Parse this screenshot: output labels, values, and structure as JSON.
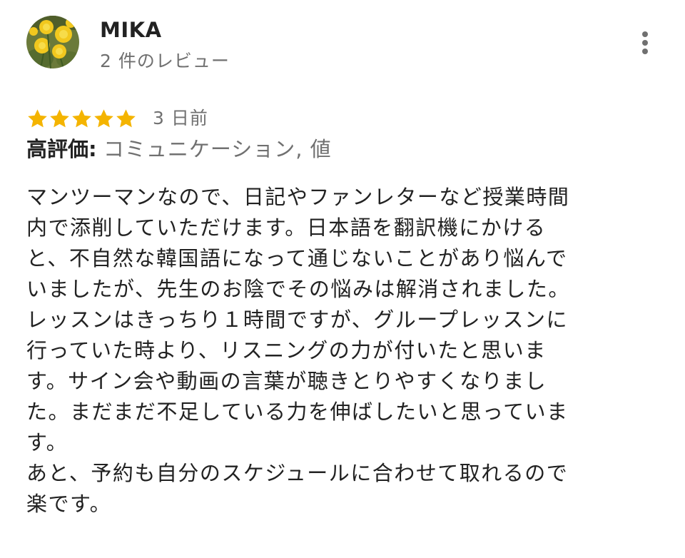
{
  "review": {
    "author": {
      "name": "MIKA",
      "review_count": "2 件のレビュー",
      "avatar_icon": "dandelion-photo-avatar"
    },
    "more_options_icon": "more-vert-icon",
    "rating": {
      "stars": 5,
      "max_stars": 5,
      "star_color": "#F4B400",
      "date": "3 日前"
    },
    "highlights": {
      "label": "高評価:",
      "values": "コミュニケーション, 値"
    },
    "body_lines": [
      "マンツーマンなので、日記やファンレターなど授業時間",
      "内で添削していただけます。日本語を翻訳機にかける",
      "と、不自然な韓国語になって通じないことがあり悩んで",
      "いましたが、先生のお陰でその悩みは解消されました。",
      "レッスンはきっちり１時間ですが、グループレッスンに",
      "行っていた時より、リスニングの力が付いたと思いま",
      "す。サイン会や動画の言葉が聴きとりやすくなりまし",
      "た。まだまだ不足している力を伸ばしたいと思っていま",
      "す。",
      "あと、予約も自分のスケジュールに合わせて取れるので",
      "楽です。"
    ]
  }
}
